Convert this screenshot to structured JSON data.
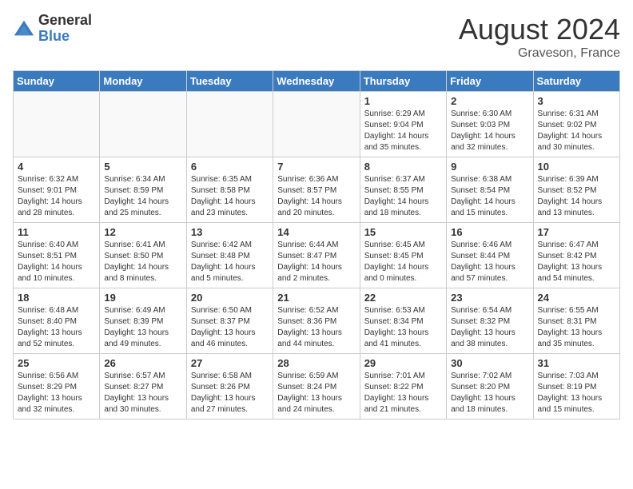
{
  "header": {
    "logo_general": "General",
    "logo_blue": "Blue",
    "month_title": "August 2024",
    "location": "Graveson, France"
  },
  "days_of_week": [
    "Sunday",
    "Monday",
    "Tuesday",
    "Wednesday",
    "Thursday",
    "Friday",
    "Saturday"
  ],
  "weeks": [
    [
      {
        "day": "",
        "info": ""
      },
      {
        "day": "",
        "info": ""
      },
      {
        "day": "",
        "info": ""
      },
      {
        "day": "",
        "info": ""
      },
      {
        "day": "1",
        "info": "Sunrise: 6:29 AM\nSunset: 9:04 PM\nDaylight: 14 hours\nand 35 minutes."
      },
      {
        "day": "2",
        "info": "Sunrise: 6:30 AM\nSunset: 9:03 PM\nDaylight: 14 hours\nand 32 minutes."
      },
      {
        "day": "3",
        "info": "Sunrise: 6:31 AM\nSunset: 9:02 PM\nDaylight: 14 hours\nand 30 minutes."
      }
    ],
    [
      {
        "day": "4",
        "info": "Sunrise: 6:32 AM\nSunset: 9:01 PM\nDaylight: 14 hours\nand 28 minutes."
      },
      {
        "day": "5",
        "info": "Sunrise: 6:34 AM\nSunset: 8:59 PM\nDaylight: 14 hours\nand 25 minutes."
      },
      {
        "day": "6",
        "info": "Sunrise: 6:35 AM\nSunset: 8:58 PM\nDaylight: 14 hours\nand 23 minutes."
      },
      {
        "day": "7",
        "info": "Sunrise: 6:36 AM\nSunset: 8:57 PM\nDaylight: 14 hours\nand 20 minutes."
      },
      {
        "day": "8",
        "info": "Sunrise: 6:37 AM\nSunset: 8:55 PM\nDaylight: 14 hours\nand 18 minutes."
      },
      {
        "day": "9",
        "info": "Sunrise: 6:38 AM\nSunset: 8:54 PM\nDaylight: 14 hours\nand 15 minutes."
      },
      {
        "day": "10",
        "info": "Sunrise: 6:39 AM\nSunset: 8:52 PM\nDaylight: 14 hours\nand 13 minutes."
      }
    ],
    [
      {
        "day": "11",
        "info": "Sunrise: 6:40 AM\nSunset: 8:51 PM\nDaylight: 14 hours\nand 10 minutes."
      },
      {
        "day": "12",
        "info": "Sunrise: 6:41 AM\nSunset: 8:50 PM\nDaylight: 14 hours\nand 8 minutes."
      },
      {
        "day": "13",
        "info": "Sunrise: 6:42 AM\nSunset: 8:48 PM\nDaylight: 14 hours\nand 5 minutes."
      },
      {
        "day": "14",
        "info": "Sunrise: 6:44 AM\nSunset: 8:47 PM\nDaylight: 14 hours\nand 2 minutes."
      },
      {
        "day": "15",
        "info": "Sunrise: 6:45 AM\nSunset: 8:45 PM\nDaylight: 14 hours\nand 0 minutes."
      },
      {
        "day": "16",
        "info": "Sunrise: 6:46 AM\nSunset: 8:44 PM\nDaylight: 13 hours\nand 57 minutes."
      },
      {
        "day": "17",
        "info": "Sunrise: 6:47 AM\nSunset: 8:42 PM\nDaylight: 13 hours\nand 54 minutes."
      }
    ],
    [
      {
        "day": "18",
        "info": "Sunrise: 6:48 AM\nSunset: 8:40 PM\nDaylight: 13 hours\nand 52 minutes."
      },
      {
        "day": "19",
        "info": "Sunrise: 6:49 AM\nSunset: 8:39 PM\nDaylight: 13 hours\nand 49 minutes."
      },
      {
        "day": "20",
        "info": "Sunrise: 6:50 AM\nSunset: 8:37 PM\nDaylight: 13 hours\nand 46 minutes."
      },
      {
        "day": "21",
        "info": "Sunrise: 6:52 AM\nSunset: 8:36 PM\nDaylight: 13 hours\nand 44 minutes."
      },
      {
        "day": "22",
        "info": "Sunrise: 6:53 AM\nSunset: 8:34 PM\nDaylight: 13 hours\nand 41 minutes."
      },
      {
        "day": "23",
        "info": "Sunrise: 6:54 AM\nSunset: 8:32 PM\nDaylight: 13 hours\nand 38 minutes."
      },
      {
        "day": "24",
        "info": "Sunrise: 6:55 AM\nSunset: 8:31 PM\nDaylight: 13 hours\nand 35 minutes."
      }
    ],
    [
      {
        "day": "25",
        "info": "Sunrise: 6:56 AM\nSunset: 8:29 PM\nDaylight: 13 hours\nand 32 minutes."
      },
      {
        "day": "26",
        "info": "Sunrise: 6:57 AM\nSunset: 8:27 PM\nDaylight: 13 hours\nand 30 minutes."
      },
      {
        "day": "27",
        "info": "Sunrise: 6:58 AM\nSunset: 8:26 PM\nDaylight: 13 hours\nand 27 minutes."
      },
      {
        "day": "28",
        "info": "Sunrise: 6:59 AM\nSunset: 8:24 PM\nDaylight: 13 hours\nand 24 minutes."
      },
      {
        "day": "29",
        "info": "Sunrise: 7:01 AM\nSunset: 8:22 PM\nDaylight: 13 hours\nand 21 minutes."
      },
      {
        "day": "30",
        "info": "Sunrise: 7:02 AM\nSunset: 8:20 PM\nDaylight: 13 hours\nand 18 minutes."
      },
      {
        "day": "31",
        "info": "Sunrise: 7:03 AM\nSunset: 8:19 PM\nDaylight: 13 hours\nand 15 minutes."
      }
    ]
  ]
}
